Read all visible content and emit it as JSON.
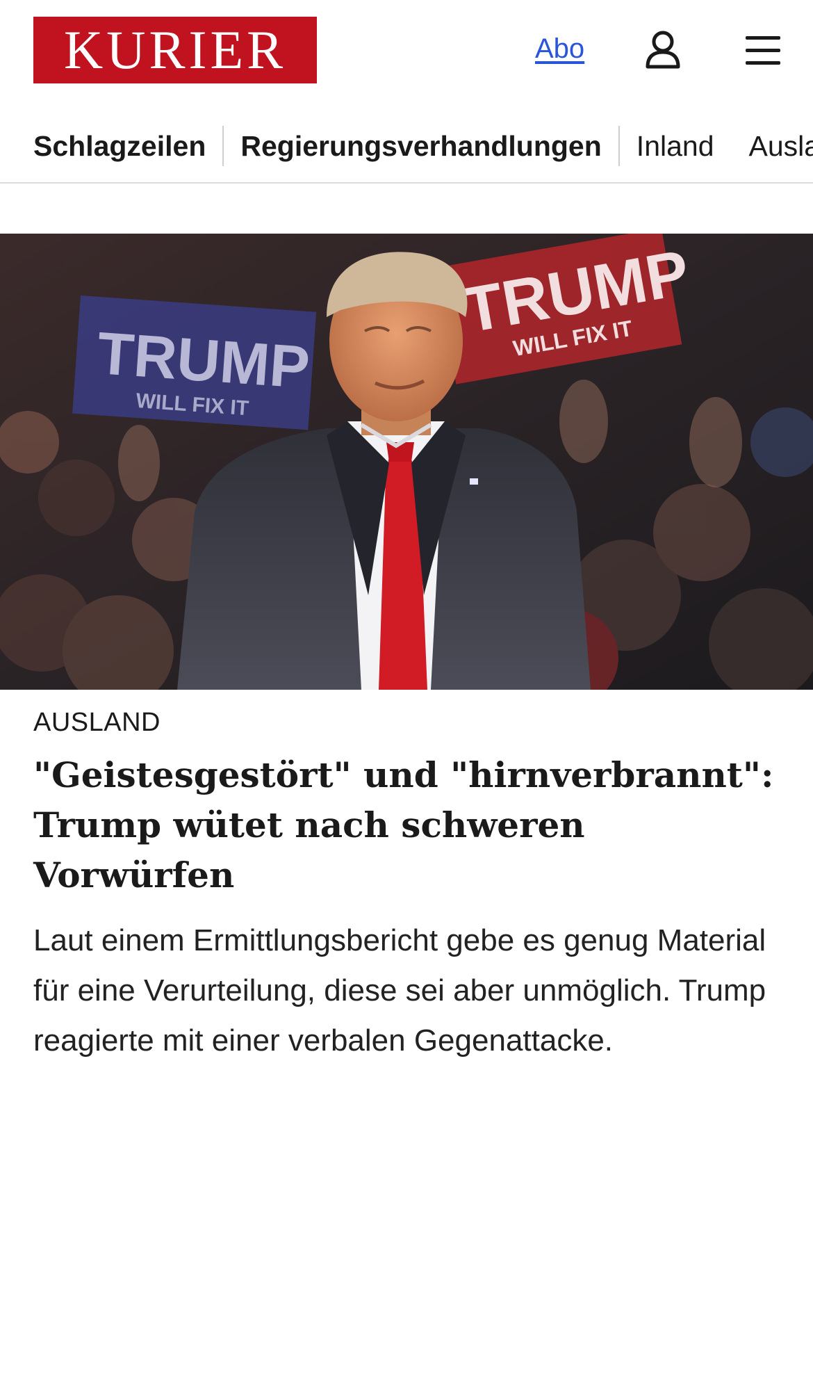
{
  "header": {
    "logo_text": "KURIER",
    "abo_label": "Abo",
    "brand_color": "#c1121f",
    "link_color": "#2a54d9",
    "icons": [
      "user-icon",
      "menu-icon"
    ]
  },
  "nav": {
    "items": [
      {
        "label": "Schlagzeilen"
      },
      {
        "label": "Regierungsverhandlungen"
      },
      {
        "label": "Inland"
      },
      {
        "label": "Ausland"
      }
    ]
  },
  "article": {
    "image_sign_1": "TRUMP",
    "image_sign_1_sub": "WILL FIX IT",
    "image_sign_2": "TRUMP",
    "image_sign_2_sub": "WILL FIX IT",
    "kicker": "AUSLAND",
    "headline": "\"Geistesgestört\" und \"hirnverbrannt\": Trump wütet nach schweren Vorwürfen",
    "teaser": "Laut einem Ermittlungsbericht gebe es genug Material für eine Verurteilung, diese sei aber unmöglich. Trump reagierte mit einer verbalen Gegenattacke."
  }
}
